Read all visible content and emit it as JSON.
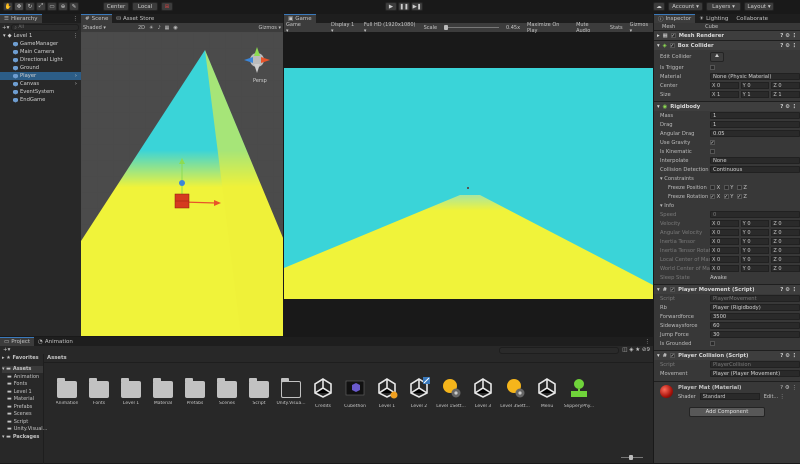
{
  "toolbar": {
    "pivot": "Center",
    "space": "Local",
    "account": "Account",
    "layers": "Layers",
    "layout": "Layout"
  },
  "hierarchy": {
    "tab": "Hierarchy",
    "search_placeholder": "All",
    "scene": "Level 1",
    "items": [
      {
        "label": "GameManager"
      },
      {
        "label": "Main Camera"
      },
      {
        "label": "Directional Light"
      },
      {
        "label": "Ground"
      },
      {
        "label": "Player"
      },
      {
        "label": "Canvas"
      },
      {
        "label": "EventSystem"
      },
      {
        "label": "EndGame"
      }
    ]
  },
  "scene": {
    "tabs": [
      "Scene",
      "Asset Store"
    ],
    "shading": "Shaded",
    "mode": "2D",
    "gizmos": "Gizmos",
    "persp": "Persp"
  },
  "game": {
    "tab": "Game",
    "view": "Game",
    "display": "Display 1",
    "resolution": "Full HD (1920x1080)",
    "scale_label": "Scale",
    "scale_value": "0.45x",
    "maximize": "Maximize On Play",
    "mute": "Mute Audio",
    "stats": "Stats",
    "gizmos": "Gizmos"
  },
  "inspector": {
    "tabs": [
      "Inspector",
      "Lighting",
      "Collaborate"
    ],
    "object_row_left": "Mesh",
    "object_row_right": "Cube",
    "mesh_renderer": "Mesh Renderer",
    "box_collider": {
      "title": "Box Collider",
      "edit": "Edit Collider",
      "is_trigger": "Is Trigger",
      "material_label": "Material",
      "material_value": "None (Physic Material)",
      "center_label": "Center",
      "center": [
        "X 0",
        "Y 0",
        "Z 0"
      ],
      "size_label": "Size",
      "size": [
        "X 1",
        "Y 1",
        "Z 1"
      ]
    },
    "rigidbody": {
      "title": "Rigidbody",
      "rows": [
        {
          "label": "Mass",
          "value": "1"
        },
        {
          "label": "Drag",
          "value": "1"
        },
        {
          "label": "Angular Drag",
          "value": "0.05"
        }
      ],
      "use_gravity": "Use Gravity",
      "is_kinematic": "Is Kinematic",
      "interpolate_label": "Interpolate",
      "interpolate_value": "None",
      "collision_label": "Collision Detection",
      "collision_value": "Continuous",
      "constraints": "Constraints",
      "freeze_pos": "Freeze Position",
      "freeze_rot": "Freeze Rotation",
      "xyz": [
        "X",
        "Y",
        "Z"
      ],
      "info": "Info",
      "speed_label": "Speed",
      "speed_value": "0",
      "info_rows": [
        {
          "label": "Velocity"
        },
        {
          "label": "Angular Velocity"
        },
        {
          "label": "Inertia Tensor"
        },
        {
          "label": "Inertia Tensor Rotation"
        },
        {
          "label": "Local Center of Mass"
        },
        {
          "label": "World Center of Mass"
        }
      ],
      "info_xyz": [
        "X 0",
        "Y 0",
        "Z 0"
      ],
      "sleep_label": "Sleep State",
      "sleep_value": "Awake"
    },
    "player_movement": {
      "title": "Player Movement (Script)",
      "script_label": "Script",
      "script_value": "PlayerMovement",
      "rb_label": "Rb",
      "rb_value": "Player (Rigidbody)",
      "rows": [
        {
          "label": "Forwardforce",
          "value": "3500"
        },
        {
          "label": "Sidewaysforce",
          "value": "60"
        },
        {
          "label": "Jump Force",
          "value": "30"
        }
      ],
      "is_grounded": "Is Grounded"
    },
    "player_collision": {
      "title": "Player Collision (Script)",
      "script_label": "Script",
      "script_value": "PlayerCollision",
      "movement_label": "Movement",
      "movement_value": "Player (Player Movement)"
    },
    "material": {
      "name": "Player Mat (Material)",
      "shader_label": "Shader",
      "shader_value": "Standard"
    },
    "add_component": "Add Component"
  },
  "project": {
    "tabs": [
      "Project",
      "Animation"
    ],
    "favorites": "Favorites",
    "assets_header": "Assets",
    "tree": [
      "Assets",
      "Animation",
      "Fonts",
      "Level 1",
      "Material",
      "Prefabs",
      "Scenes",
      "Script",
      "Unity.Visual...",
      "Packages"
    ],
    "assets": [
      {
        "label": "Animation",
        "kind": "folder"
      },
      {
        "label": "Fonts",
        "kind": "folder"
      },
      {
        "label": "Level 1",
        "kind": "folder"
      },
      {
        "label": "Material",
        "kind": "folder"
      },
      {
        "label": "Prefabs",
        "kind": "folder"
      },
      {
        "label": "Scenes",
        "kind": "folder"
      },
      {
        "label": "Script",
        "kind": "folder"
      },
      {
        "label": "Unity.Visua...",
        "kind": "folder-empty"
      },
      {
        "label": "Credits",
        "kind": "unity"
      },
      {
        "label": "Cubethon",
        "kind": "video"
      },
      {
        "label": "Level 1",
        "kind": "unity-badge"
      },
      {
        "label": "Level 2",
        "kind": "unity-edit"
      },
      {
        "label": "Level 1Sett...",
        "kind": "light"
      },
      {
        "label": "Level 3",
        "kind": "unity"
      },
      {
        "label": "Level 3Sett...",
        "kind": "light"
      },
      {
        "label": "Menu",
        "kind": "unity"
      },
      {
        "label": "SlipperyPhy...",
        "kind": "physic"
      }
    ]
  },
  "colors": {
    "sky": "#3ad4d8",
    "ground": "#f0f33a",
    "selection": "#2c5d87",
    "accent": "#3a79bb"
  }
}
